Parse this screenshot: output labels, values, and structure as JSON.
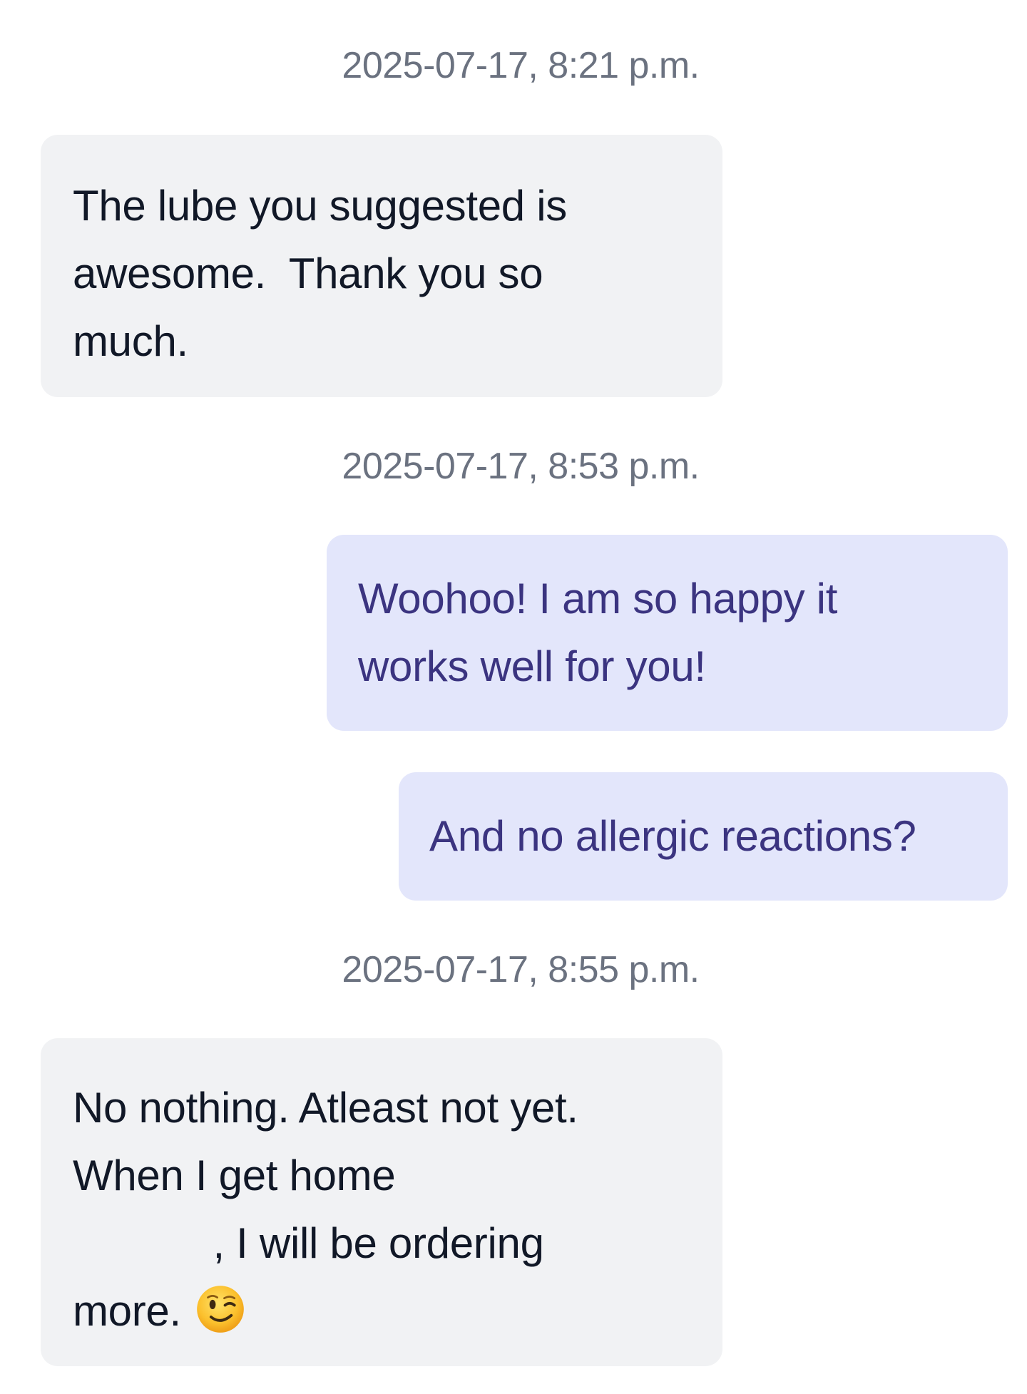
{
  "messages": [
    {
      "type": "timestamp",
      "text": "2025-07-17, 8:21 p.m."
    },
    {
      "type": "incoming",
      "lines": [
        "The lube you suggested is",
        "awesome.  Thank you so",
        "much."
      ]
    },
    {
      "type": "timestamp",
      "text": "2025-07-17, 8:53 p.m."
    },
    {
      "type": "outgoing",
      "lines": [
        "Woohoo! I am so happy it",
        "works well for you!"
      ]
    },
    {
      "type": "outgoing",
      "lines": [
        "And no allergic reactions?"
      ]
    },
    {
      "type": "timestamp",
      "text": "2025-07-17, 8:55 p.m."
    },
    {
      "type": "incoming",
      "lines": [
        "No nothing. Atleast not yet.",
        "When I get home",
        "            , I will be ordering",
        "more."
      ],
      "emoji": "winking-face-emoji"
    }
  ],
  "colors": {
    "background": "#ffffff",
    "incoming_bubble": "#f1f2f4",
    "incoming_text": "#111827",
    "outgoing_bubble": "#e3e6fb",
    "outgoing_text": "#3b3480",
    "timestamp_text": "#6b7280"
  }
}
